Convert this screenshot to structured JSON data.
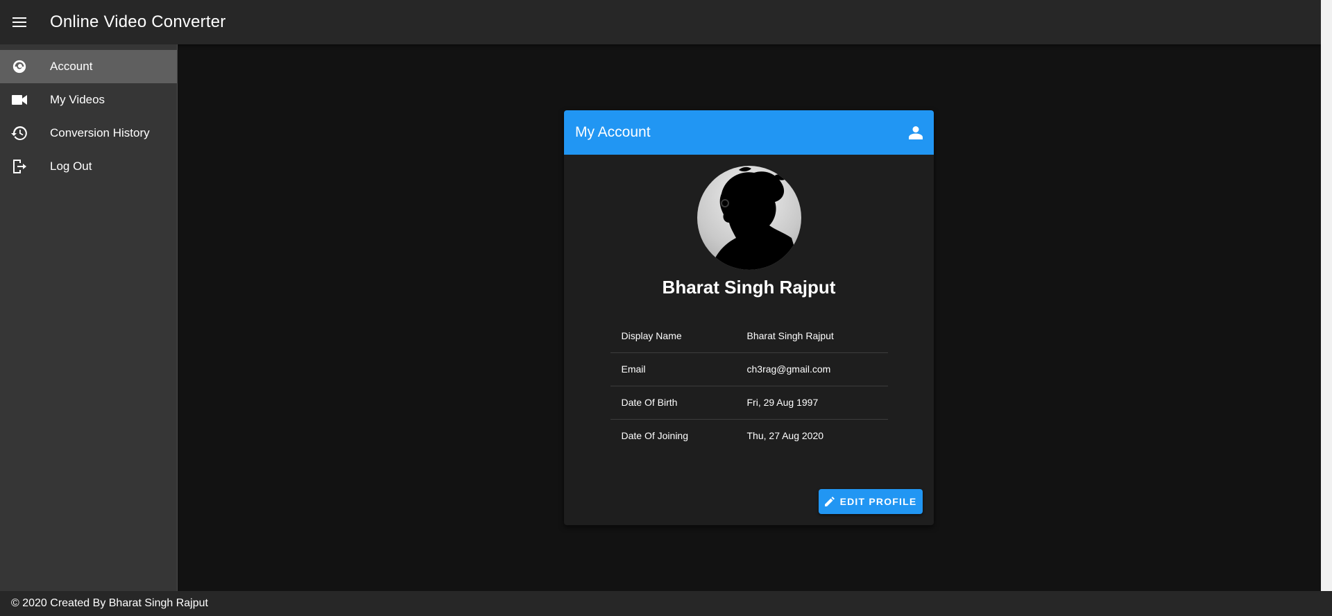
{
  "app": {
    "title": "Online Video Converter"
  },
  "sidebar": {
    "items": [
      {
        "label": "Account",
        "icon": "account-icon"
      },
      {
        "label": "My Videos",
        "icon": "video-camera-icon"
      },
      {
        "label": "Conversion History",
        "icon": "history-icon"
      },
      {
        "label": "Log Out",
        "icon": "logout-icon"
      }
    ]
  },
  "card": {
    "title": "My Account",
    "header_icon": "person-icon",
    "user_name": "Bharat Singh Rajput",
    "fields": [
      {
        "label": "Display Name",
        "value": "Bharat Singh Rajput"
      },
      {
        "label": "Email",
        "value": "ch3rag@gmail.com"
      },
      {
        "label": "Date Of Birth",
        "value": "Fri, 29 Aug 1997"
      },
      {
        "label": "Date Of Joining",
        "value": "Thu, 27 Aug 2020"
      }
    ],
    "edit_button": "EDIT PROFILE"
  },
  "footer": {
    "text": "© 2020 Created By Bharat Singh Rajput"
  },
  "colors": {
    "accent": "#2196f3",
    "appbar": "#272727",
    "sidebar": "#363636",
    "background": "#121212",
    "card": "#1e1e1e"
  }
}
